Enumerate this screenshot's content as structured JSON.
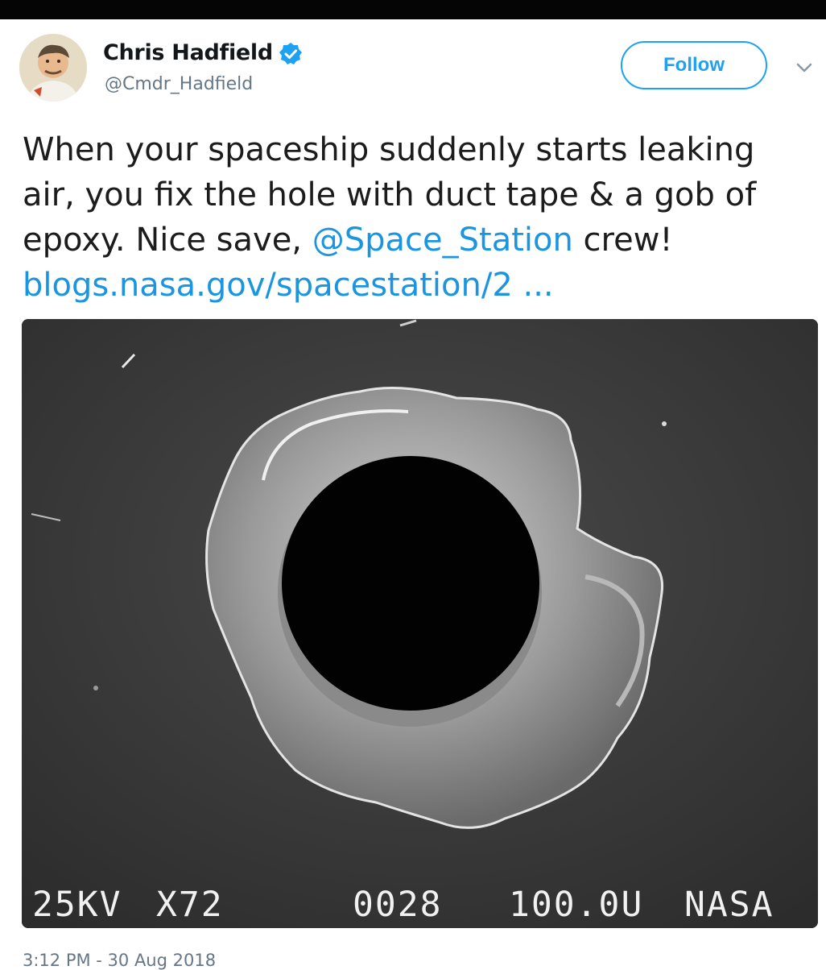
{
  "tweet": {
    "author": {
      "display_name": "Chris Hadfield",
      "handle": "@Cmdr_Hadfield",
      "verified": true
    },
    "follow_label": "Follow",
    "text": {
      "line1": "When your spaceship suddenly starts leaking",
      "line2": "air, you fix the hole with duct tape & a gob of",
      "line3_before": "epoxy. Nice save, ",
      "mention": "@Space_Station",
      "line3_after": " crew!",
      "url": "blogs.nasa.gov/spacestation/2  ..."
    },
    "media": {
      "description": "Scanning electron micrograph of a round hole",
      "labels": {
        "voltage": "25KV",
        "magnification": "X72",
        "frame": "0028",
        "scale": "100.0U",
        "source": "NASA"
      }
    },
    "timestamp": "3:12 PM - 30 Aug 2018"
  },
  "colors": {
    "link": "#1b95e0",
    "follow_border": "#1da1f2",
    "secondary_text": "#657786"
  },
  "icons": [
    "verified-badge-icon",
    "chevron-down-icon"
  ]
}
